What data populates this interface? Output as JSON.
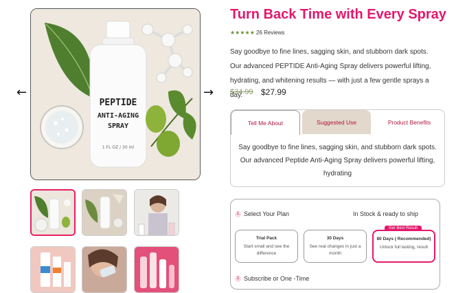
{
  "gallery": {
    "prev_icon": "arrow-left-icon",
    "next_icon": "arrow-right-icon",
    "bottle_text": [
      "PEPTIDE",
      "ANTI-AGING",
      "SPRAY"
    ],
    "bottle_volume": "1 FL OZ / 30 ml"
  },
  "product": {
    "title": "Turn Back Time with Every Spray",
    "stars": "★★★★★",
    "reviews": "26 Reviews",
    "description": "Say goodbye to fine lines, sagging skin, and stubborn dark spots. Our advanced PEPTIDE Anti-Aging Spray delivers powerful lifting, hydrating, and whitening results — with just a few gentle sprays a day.",
    "price_old": "$34.99",
    "price_new": "$27.99"
  },
  "tabs": {
    "items": [
      {
        "label": "Tell Me About"
      },
      {
        "label": "Suggested Use"
      },
      {
        "label": "Product Benefits"
      }
    ],
    "content": "Say goodbye to fine lines, sagging skin, and stubborn dark spots. Our advanced Peptide Anti-Aging Spray delivers powerful lifting, hydrating"
  },
  "plan": {
    "step1_num": "1",
    "step1_label": "Select Your Plan",
    "stock": "In Stock & ready to ship",
    "cards": [
      {
        "title": "Trial Pack",
        "desc": "Start small and see the difference"
      },
      {
        "title": "30 Days",
        "desc": "See real changes in just a month"
      },
      {
        "title": "80 Days ( Recommended)",
        "desc": "Unlock full lasting, result",
        "badge": "Get Best Result"
      }
    ],
    "step2_num": "2",
    "step2_label": "Subscribe or One -Time"
  },
  "colors": {
    "accent": "#e4176c",
    "tab_active_bg": "#e2d8cc"
  }
}
